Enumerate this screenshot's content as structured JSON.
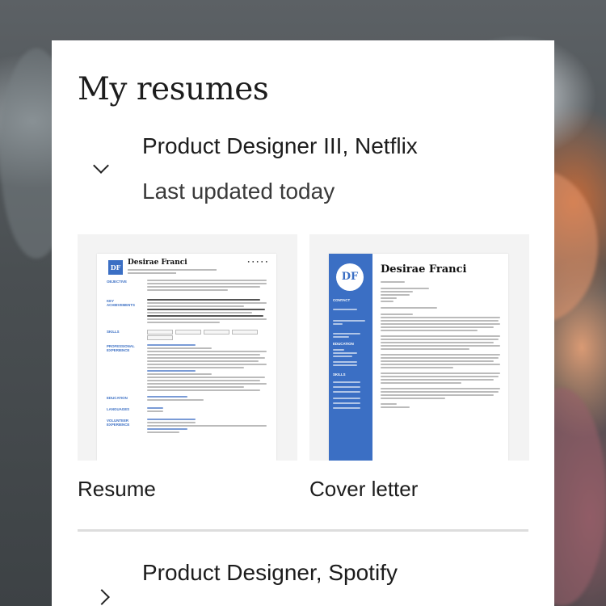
{
  "page": {
    "title": "My resumes"
  },
  "resumes": [
    {
      "name": "Product Designer III, Netflix",
      "updated": "Last updated today",
      "expanded": true,
      "documents": [
        {
          "label": "Resume"
        },
        {
          "label": "Cover letter"
        }
      ]
    },
    {
      "name": "Product Designer, Spotify",
      "expanded": false
    }
  ],
  "resume_preview": {
    "monogram": "DF",
    "name": "Desirae Franci",
    "sections": [
      "OBJECTIVE",
      "KEY ACHIEVEMENTS",
      "SKILLS",
      "PROFESSIONAL EXPERIENCE",
      "EDUCATION",
      "LANGUAGES",
      "VOLUNTEER EXPERIENCE"
    ]
  },
  "cover_preview": {
    "monogram": "DF",
    "name": "Desirae Franci",
    "sections": [
      "CONTACT",
      "EDUCATION",
      "SKILLS"
    ]
  },
  "icons": {
    "expand": "chevron-down-icon",
    "collapse": "chevron-right-icon"
  },
  "colors": {
    "accent": "#3b6fc4",
    "card": "#ffffff",
    "thumb_bg": "#f3f3f3"
  }
}
